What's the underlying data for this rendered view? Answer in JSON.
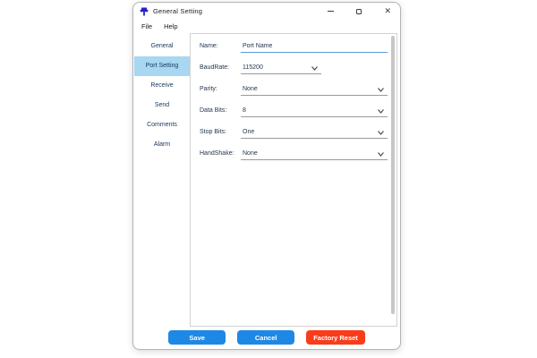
{
  "window": {
    "title": "General Setting",
    "close_glyph": "✕"
  },
  "menu": {
    "items": [
      "File",
      "Help"
    ]
  },
  "sidebar": {
    "items": [
      {
        "label": "General",
        "selected": false
      },
      {
        "label": "Port Setting",
        "selected": true
      },
      {
        "label": "Receive",
        "selected": false
      },
      {
        "label": "Send",
        "selected": false
      },
      {
        "label": "Comments",
        "selected": false
      },
      {
        "label": "Alarm",
        "selected": false
      }
    ]
  },
  "form": {
    "fields": [
      {
        "label": "Name:",
        "value": "Port Name",
        "type": "text",
        "width": "full"
      },
      {
        "label": "BaudRate:",
        "value": "115200",
        "type": "select",
        "width": "short"
      },
      {
        "label": "Parity:",
        "value": "None",
        "type": "select",
        "width": "full"
      },
      {
        "label": "Data Bits:",
        "value": "8",
        "type": "select",
        "width": "full"
      },
      {
        "label": "Stop Bits:",
        "value": "One",
        "type": "select",
        "width": "full"
      },
      {
        "label": "HandShake:",
        "value": "None",
        "type": "select",
        "width": "full"
      }
    ]
  },
  "footer": {
    "buttons": [
      {
        "label": "Save",
        "color": "#1E88E5"
      },
      {
        "label": "Cancel",
        "color": "#1E88E5"
      },
      {
        "label": "Factory Reset",
        "color": "#F93C1A"
      }
    ]
  },
  "colors": {
    "sidebar_selected_bg": "#A7D7F1",
    "text_navy": "#25364E",
    "focus_underline": "#5B9BD5",
    "app_icon_blue": "#2323CE"
  }
}
